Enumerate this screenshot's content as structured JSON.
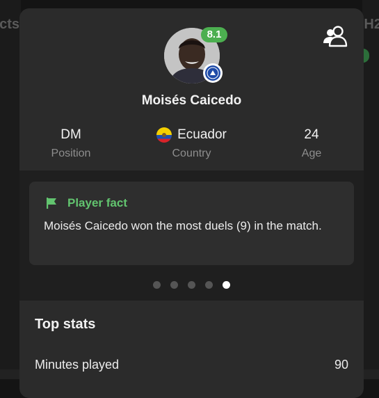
{
  "background": {
    "left_tab_text": "acts",
    "right_tab_text": "H2"
  },
  "player": {
    "name": "Moisés Caicedo",
    "rating": "8.1",
    "club_icon": "chelsea-badge-icon"
  },
  "info": {
    "position": {
      "value": "DM",
      "label": "Position"
    },
    "country": {
      "value": "Ecuador",
      "label": "Country",
      "flag_icon": "ecuador-flag-icon"
    },
    "age": {
      "value": "24",
      "label": "Age"
    }
  },
  "fact": {
    "title": "Player fact",
    "text": "Moisés Caicedo won the most duels (9) in the match.",
    "icon": "flag-icon",
    "pager_total": 5,
    "pager_active": 5
  },
  "top_stats": {
    "title": "Top stats",
    "rows": [
      {
        "label": "Minutes played",
        "value": "90"
      }
    ]
  },
  "colors": {
    "accent_green": "#62c46f",
    "rating_green": "#4caf50",
    "card_bg": "#2b2b2b"
  }
}
